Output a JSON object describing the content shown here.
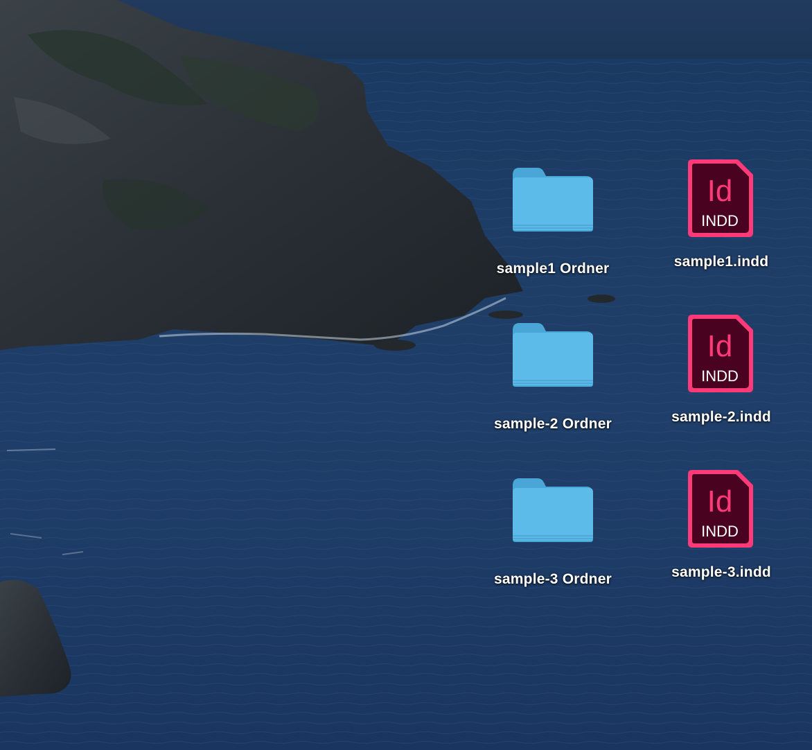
{
  "desktop": {
    "wallpaper": "coastal-cliffs-evening",
    "colors": {
      "sea": "#1f3d66",
      "folder": "#5ab8e8",
      "indesign_bg": "#49021f",
      "indesign_accent": "#ff3366"
    },
    "icons": [
      {
        "type": "folder",
        "icon": "folder-icon",
        "label": "sample1 Ordner"
      },
      {
        "type": "indd",
        "icon": "indesign-file-icon",
        "label": "sample1.indd",
        "glyph": "Id",
        "ext": "INDD"
      },
      {
        "type": "folder",
        "icon": "folder-icon",
        "label": "sample-2 Ordner"
      },
      {
        "type": "indd",
        "icon": "indesign-file-icon",
        "label": "sample-2.indd",
        "glyph": "Id",
        "ext": "INDD"
      },
      {
        "type": "folder",
        "icon": "folder-icon",
        "label": "sample-3 Ordner"
      },
      {
        "type": "indd",
        "icon": "indesign-file-icon",
        "label": "sample-3.indd",
        "glyph": "Id",
        "ext": "INDD"
      }
    ]
  }
}
